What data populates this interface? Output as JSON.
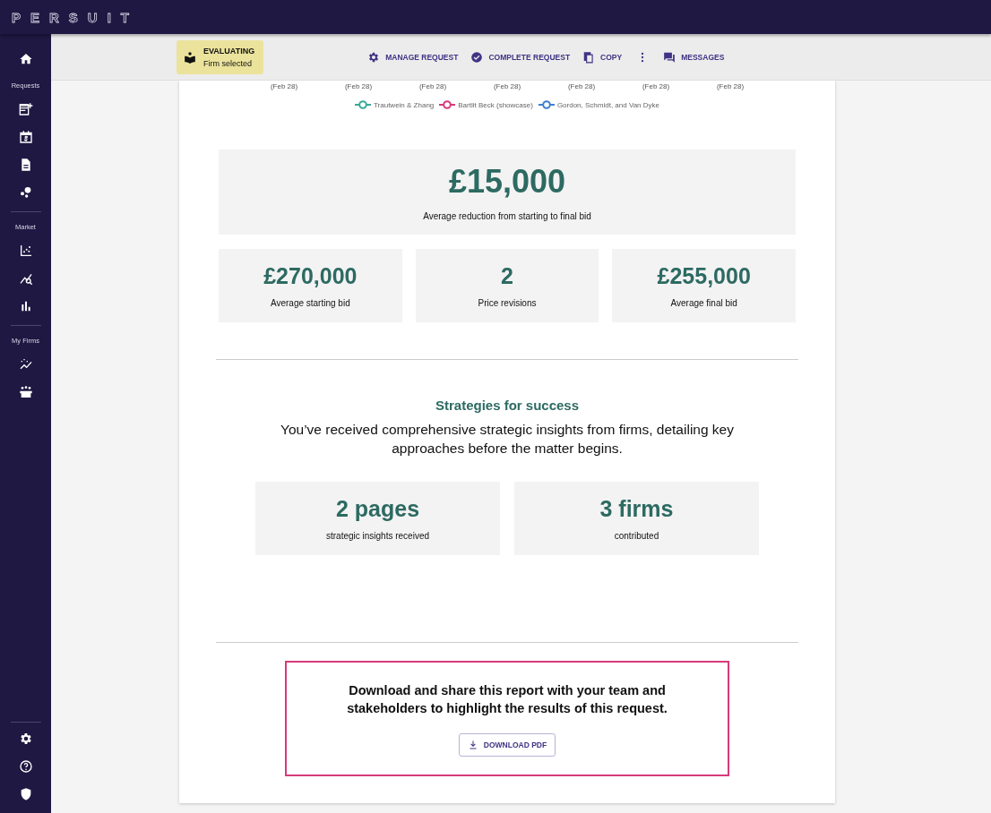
{
  "brand": "PERSUIT",
  "sidebar": {
    "sections": [
      "Requests",
      "Market",
      "My Firms"
    ]
  },
  "status": {
    "title": "EVALUATING",
    "subtitle": "Firm selected"
  },
  "actions": [
    "MANAGE REQUEST",
    "COMPLETE REQUEST",
    "COPY",
    "MESSAGES"
  ],
  "chart_axis": {
    "dates": [
      "(Feb 28)",
      "(Feb 28)",
      "(Feb 28)",
      "(Feb 28)",
      "(Feb 28)",
      "(Feb 28)",
      "(Feb 28)"
    ]
  },
  "legend": [
    {
      "name": "Trautwein & Zhang",
      "color": "#3aa99a"
    },
    {
      "name": "Bartlit Beck (showcase)",
      "color": "#d63a7a"
    },
    {
      "name": "Gordon, Schmidt, and Van Dyke",
      "color": "#3f7fd0"
    }
  ],
  "headline": {
    "value": "£15,000",
    "label": "Average reduction from starting to final bid"
  },
  "stats": [
    {
      "value": "£270,000",
      "label": "Average starting bid"
    },
    {
      "value": "2",
      "label": "Price revisions"
    },
    {
      "value": "£255,000",
      "label": "Average final bid"
    }
  ],
  "strategies": {
    "title": "Strategies for success",
    "text": "You’ve received comprehensive strategic insights from firms, detailing key approaches before the matter begins.",
    "stats": [
      {
        "value": "2 pages",
        "label": "strategic insights received"
      },
      {
        "value": "3 firms",
        "label": "contributed"
      }
    ]
  },
  "download": {
    "text": "Download and share this report with your team and stakeholders to highlight the results of this request.",
    "button": "DOWNLOAD PDF"
  }
}
